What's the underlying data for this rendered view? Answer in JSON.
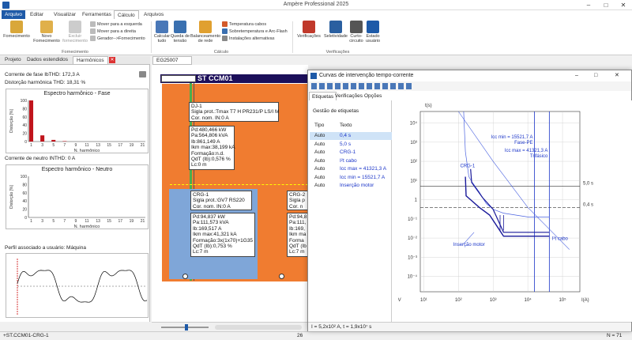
{
  "app": {
    "title": "Ampère Professional 2025"
  },
  "tabs": [
    {
      "label": "Arquivo"
    },
    {
      "label": "Editar"
    },
    {
      "label": "Visualizar"
    },
    {
      "label": "Ferramentas"
    },
    {
      "label": "Cálculo"
    },
    {
      "label": "Arquivos"
    }
  ],
  "ribbon": {
    "fornecimento": {
      "label": "Fornecimento",
      "novo": "Novo Fornecimento",
      "excluir": "Excluir fornecimento",
      "group": "Fornecimento",
      "mover_esq": "Mover para a esquerda",
      "mover_dir": "Mover para a direita",
      "gerador": "Gerador-->Fornecimento"
    },
    "calculo": {
      "calcular": "Calcular tudo",
      "queda": "Queda de tensão",
      "balanceamento": "Balanceamento de rede",
      "temp": "Temperatura cabos",
      "sobretemp": "Sobretemperatura e Arc-Flash",
      "inst": "Instalações alternativas",
      "group": "Cálculo"
    },
    "verificacoes": {
      "verif": "Verificações",
      "selet": "Seletividade",
      "curto": "Curto-circuito",
      "estado": "Estado usuário",
      "group": "Verificações"
    }
  },
  "left": {
    "tabs": [
      "Projeto",
      "Dados estendidos",
      "Harmônicos"
    ],
    "corrente_fase": "Corrente de fase IbTHD: 172,3 A",
    "thd": "Distorção harmônica THD: 18,31 %",
    "chart1_title": "Espectro harmônico - Fase",
    "corrente_neutro": "Corrente de neutro INTHD: 0 A",
    "chart2_title": "Espectro harmônico - Neutro",
    "perfil": "Perfil associado a usuário: Máquina",
    "ylabel": "Distorção [%]",
    "xlabel": "N. harmônico"
  },
  "chart_data": [
    {
      "type": "bar",
      "title": "Espectro harmônico - Fase",
      "xlabel": "N. harmônico",
      "ylabel": "Distorção [%]",
      "categories": [
        1,
        2,
        3,
        4,
        5,
        6,
        7,
        8,
        9,
        10,
        11,
        12,
        13,
        14,
        15,
        16,
        17,
        18,
        19,
        20,
        21
      ],
      "values": [
        100,
        0,
        15,
        0,
        4,
        0,
        1,
        0,
        0,
        0,
        0,
        0,
        0,
        0,
        0,
        0,
        0,
        0,
        0,
        0,
        0
      ],
      "ylim": [
        0,
        100
      ],
      "yticks": [
        0,
        20,
        40,
        60,
        80,
        100
      ],
      "xticks": [
        1,
        3,
        5,
        7,
        9,
        11,
        13,
        15,
        17,
        19,
        21
      ]
    },
    {
      "type": "bar",
      "title": "Espectro harmônico - Neutro",
      "xlabel": "N. harmônico",
      "ylabel": "Distorção [%]",
      "categories": [
        1,
        3,
        5,
        7,
        9,
        11,
        13,
        15,
        17,
        19,
        21
      ],
      "values": [
        0,
        0,
        0,
        0,
        0,
        0,
        0,
        0,
        0,
        0,
        0
      ],
      "ylim": [
        0,
        100
      ],
      "yticks": [
        0,
        20,
        40,
        60,
        80,
        100
      ],
      "xticks": [
        1,
        3,
        5,
        7,
        9,
        11,
        13,
        15,
        17,
        19,
        21
      ]
    }
  ],
  "doc": {
    "tab": "EG25007",
    "bus": "ST CCM01",
    "dj": [
      "DJ-1",
      "Sigla prot.:Tmax T7 H PR231/P LS/I M",
      "Cor. nom. IN:0 A"
    ],
    "dj_res": [
      "Pd:480,466 kW",
      "Pa:564,806 kVA",
      "Ib:861,149 A",
      "Ikm max:38,199 kA",
      "Formação:n.d.",
      "QdT (Ib):0,576 %",
      "Lc:0 m"
    ],
    "crg1": [
      "CRG-1",
      "Sigla prot.:GV7 RS220",
      "Cor. nom. IN:0 A"
    ],
    "crg1_res": [
      "Pd:94,837 kW",
      "Pa:111,573 kVA",
      "Ib:169,517 A",
      "Ikm max:41,321 kA",
      "Formação:3x(1x70)+1G35",
      "QdT (Ib):0,753 %",
      "Lc:7 m"
    ],
    "crg2": [
      "CRG-2",
      "Sigla p",
      "Cor. n"
    ],
    "crg2_res": [
      "Pd:94,8",
      "Pa:111,",
      "Ib:169,",
      "Ikm ma",
      "Forma",
      "QdT (Ib",
      "Lc:7 m"
    ]
  },
  "dialog": {
    "title": "Curvas de intervenção tempo-corrente",
    "tabs": [
      "Etiquetas",
      "Verificações",
      "Opções"
    ],
    "gestao": "Gestão de etiquetas",
    "col_tipo": "Tipo",
    "col_texto": "Texto",
    "rows": [
      {
        "tipo": "Auto",
        "texto": "0,4 s"
      },
      {
        "tipo": "Auto",
        "texto": "5,0 s"
      },
      {
        "tipo": "Auto",
        "texto": "CRG-1"
      },
      {
        "tipo": "Auto",
        "texto": "I²t cabo"
      },
      {
        "tipo": "Auto",
        "texto": "Icc max = 41321,3 A"
      },
      {
        "tipo": "Auto",
        "texto": "Icc min = 15521,7 A"
      },
      {
        "tipo": "Auto",
        "texto": "Inserção motor"
      }
    ],
    "status": "I = 5,2x10² A, t = 1,9x10⁷ s",
    "graph": {
      "ylabel": "t(s)",
      "xlabel": "I(A)",
      "voltage": "380 V",
      "yticks": [
        "10⁴",
        "10³",
        "10²",
        "10¹",
        "1",
        "10⁻¹",
        "10⁻²",
        "10⁻³",
        "10⁻⁴"
      ],
      "xticks": [
        "10¹",
        "10²",
        "10³",
        "10⁴",
        "10⁵"
      ],
      "labels": {
        "icc_min": "Icc min = 15521,7 A",
        "fase_pe": "Fase-PE",
        "icc_max": "Icc max = 41321,3 A",
        "trifasico": "Trifásico",
        "crg": "CRG-1",
        "t5": "5,0 s",
        "t04": "0,4 s",
        "insercao": "Inserção motor",
        "i2t": "I²t cabo"
      }
    }
  },
  "status": {
    "left": "+ST.CCM01-CRG-1",
    "center": "26",
    "right": "N = 71"
  }
}
